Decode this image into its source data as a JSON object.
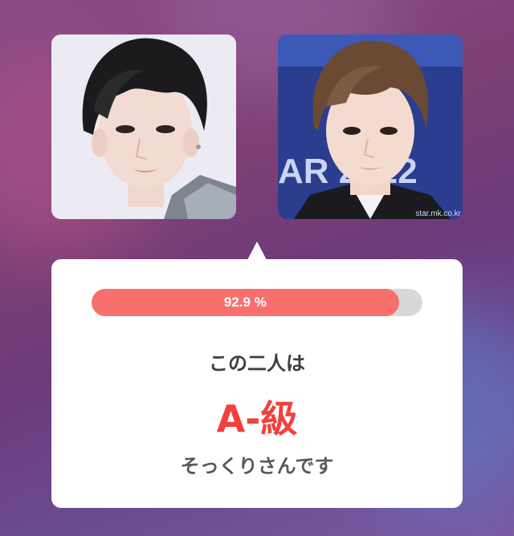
{
  "result": {
    "similarity_text": "92.9 %",
    "similarity_percent": 92.9,
    "line1": "この二人は",
    "grade": "A-級",
    "line3": "そっくりさんです"
  },
  "photos": {
    "right_watermark": "star.mk.co.kr",
    "right_backdrop_text": "AR 2022"
  },
  "colors": {
    "bar_fill": "#f8706d",
    "bar_track": "#d8d8d8",
    "grade": "#f2413c"
  }
}
